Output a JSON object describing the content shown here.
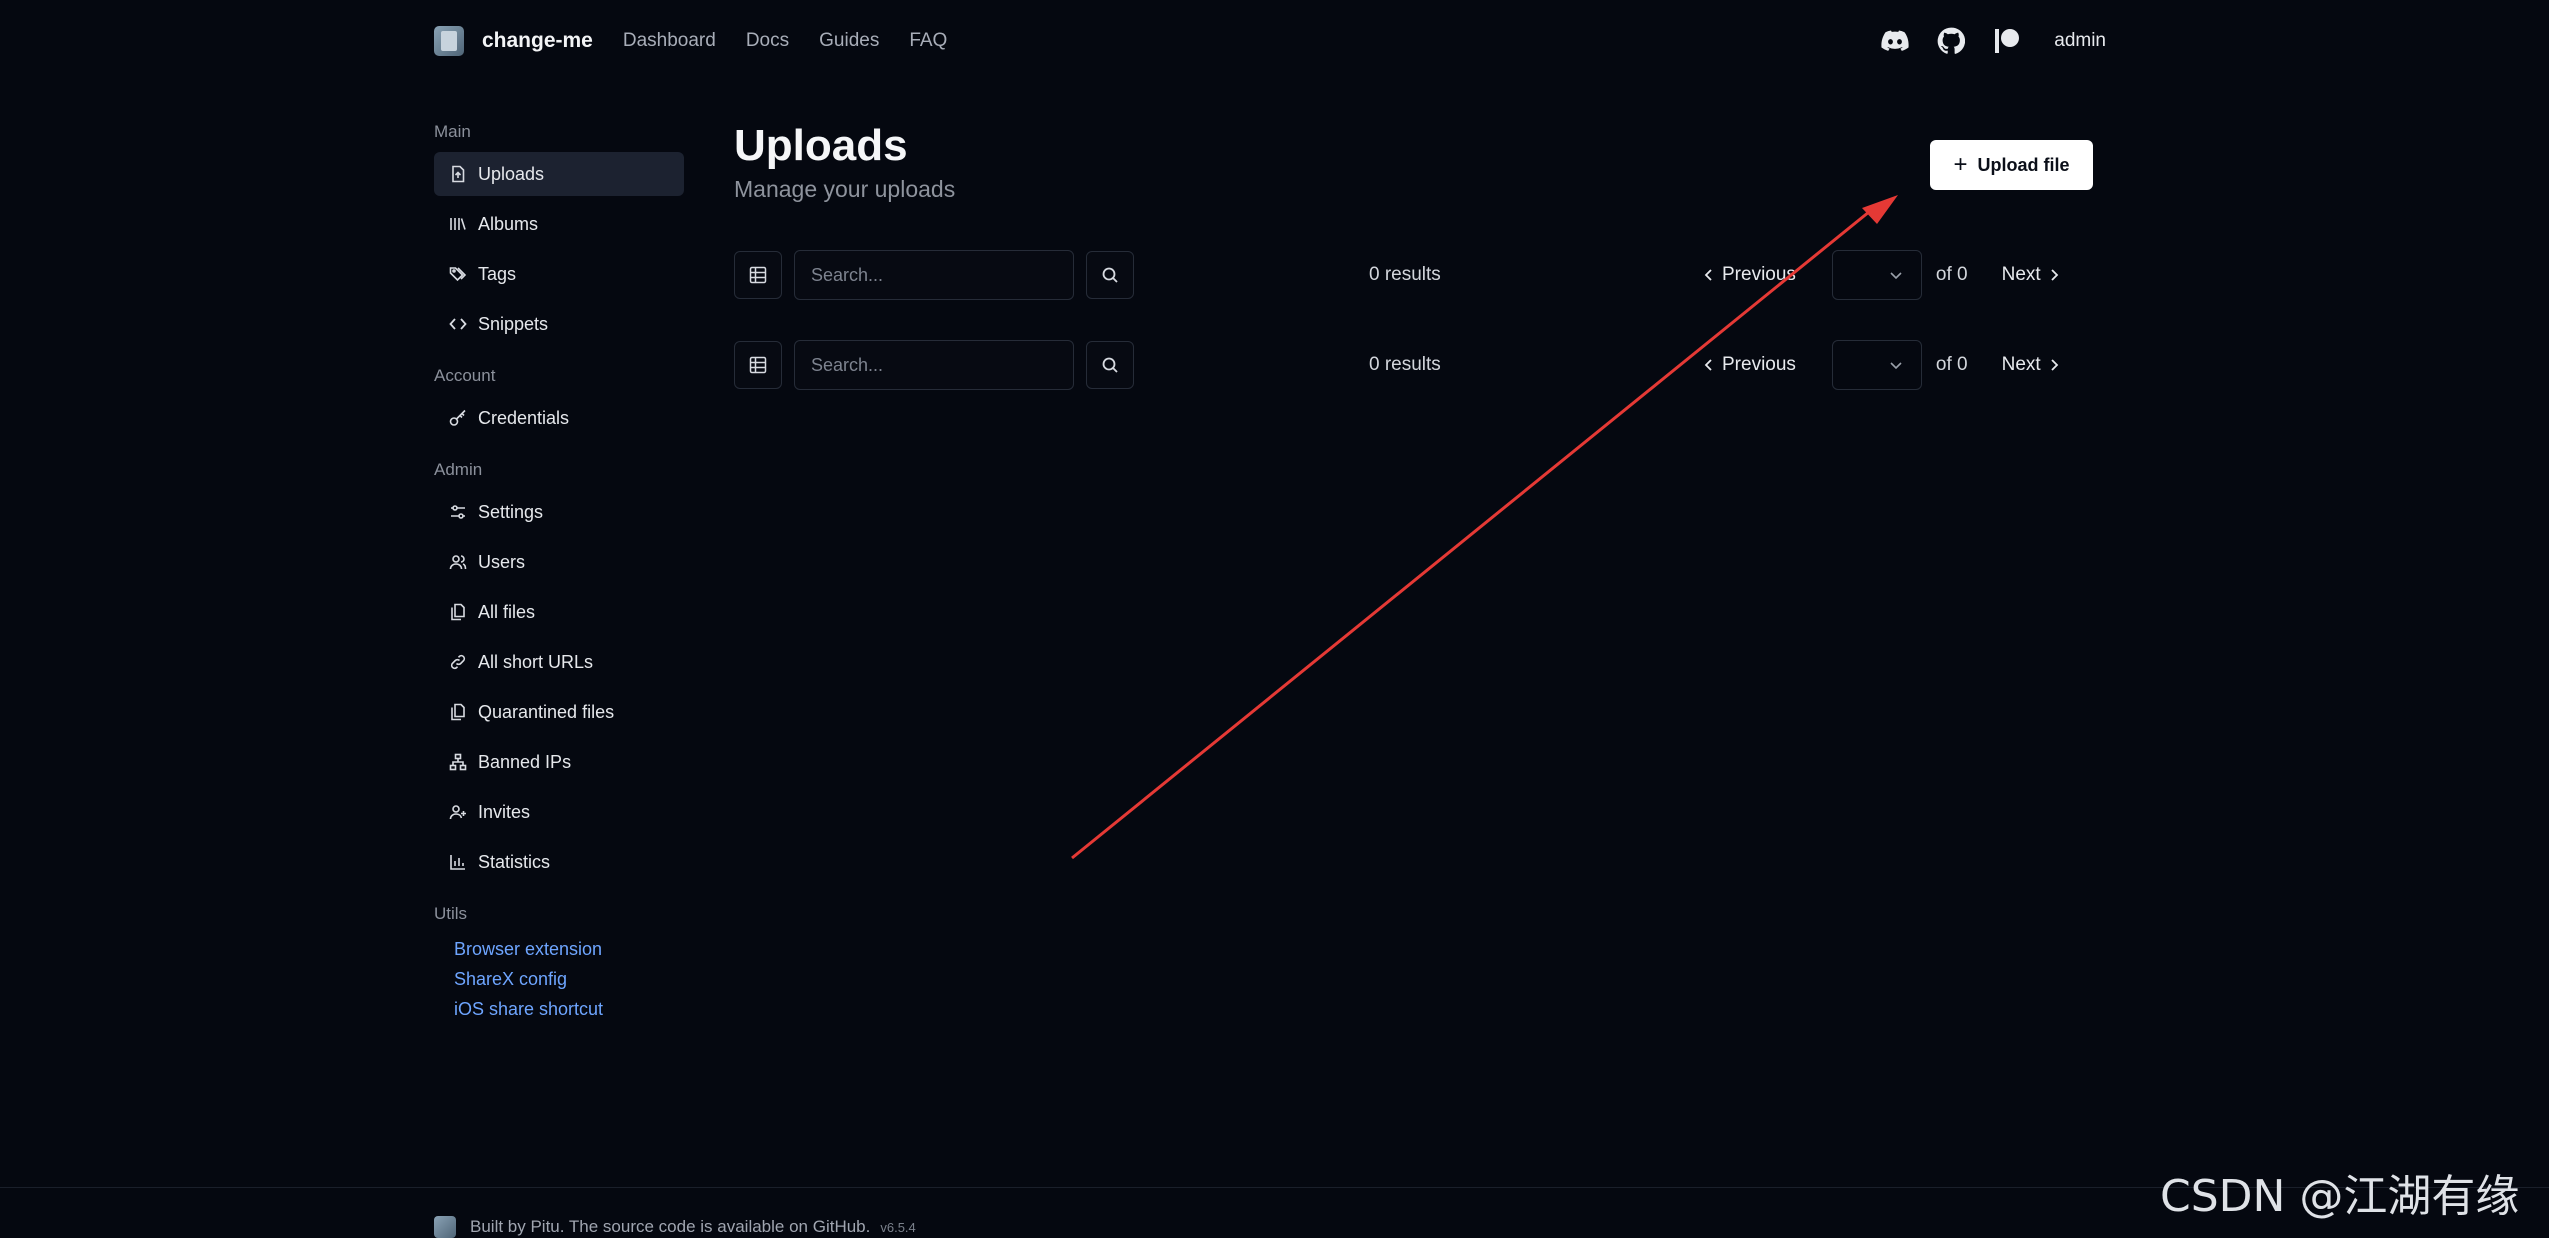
{
  "header": {
    "brand": "change-me",
    "nav": [
      "Dashboard",
      "Docs",
      "Guides",
      "FAQ"
    ],
    "icons": [
      "discord-icon",
      "github-icon",
      "patreon-icon"
    ],
    "user": "admin"
  },
  "sidebar": {
    "sections": {
      "main": "Main",
      "account": "Account",
      "admin": "Admin",
      "utils": "Utils"
    },
    "main_items": [
      {
        "label": "Uploads",
        "icon": "file-upload-icon",
        "active": true
      },
      {
        "label": "Albums",
        "icon": "library-icon"
      },
      {
        "label": "Tags",
        "icon": "tags-icon"
      },
      {
        "label": "Snippets",
        "icon": "code-icon"
      }
    ],
    "account_items": [
      {
        "label": "Credentials",
        "icon": "key-icon"
      }
    ],
    "admin_items": [
      {
        "label": "Settings",
        "icon": "sliders-icon"
      },
      {
        "label": "Users",
        "icon": "users-icon"
      },
      {
        "label": "All files",
        "icon": "files-icon"
      },
      {
        "label": "All short URLs",
        "icon": "link-icon"
      },
      {
        "label": "Quarantined files",
        "icon": "files-icon"
      },
      {
        "label": "Banned IPs",
        "icon": "network-icon"
      },
      {
        "label": "Invites",
        "icon": "user-plus-icon"
      },
      {
        "label": "Statistics",
        "icon": "chart-icon"
      }
    ],
    "utils_links": [
      "Browser extension",
      "ShareX config",
      "iOS share shortcut"
    ]
  },
  "main": {
    "title": "Uploads",
    "subtitle": "Manage your uploads",
    "upload_button": "Upload file",
    "toolbars": [
      {
        "search_placeholder": "Search...",
        "results": "0 results",
        "previous": "Previous",
        "of": "of 0",
        "next": "Next"
      },
      {
        "search_placeholder": "Search...",
        "results": "0 results",
        "previous": "Previous",
        "of": "of 0",
        "next": "Next"
      }
    ]
  },
  "footer": {
    "text": "Built by Pitu. The source code is available on GitHub.",
    "version": "v6.5.4"
  },
  "watermark": "CSDN @江湖有缘",
  "colors": {
    "background": "#050810",
    "accent_link": "#6ea5ff",
    "annotation_arrow": "#e53935"
  }
}
